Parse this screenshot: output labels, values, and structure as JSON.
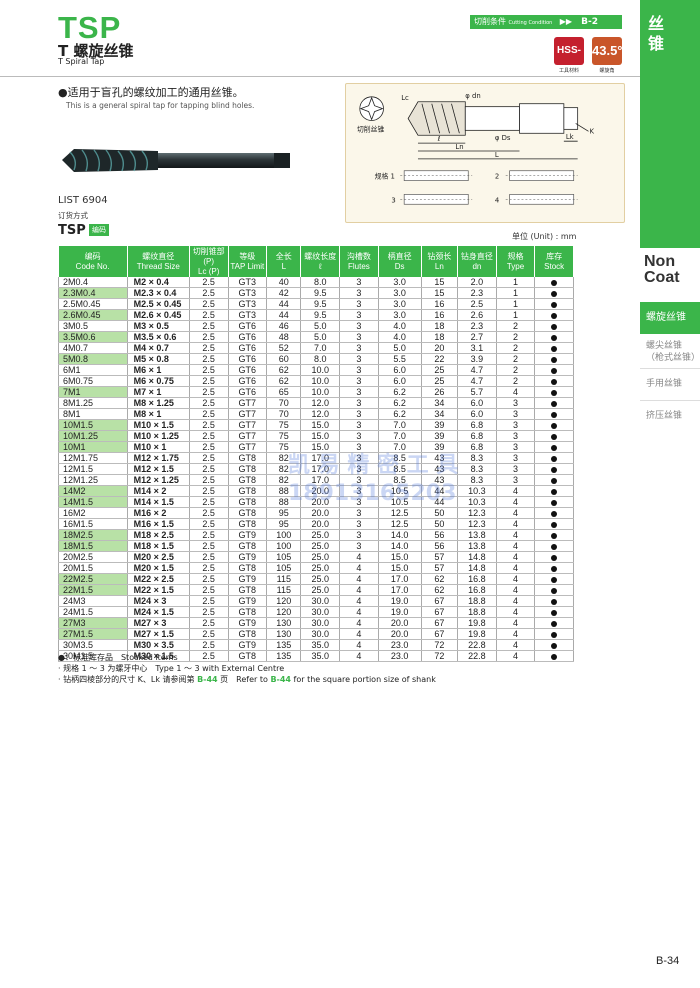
{
  "header": {
    "code": "TSP",
    "title_cn": "T 螺旋丝锥",
    "title_en": "T Spiral Tap",
    "cutting_condition_cn": "切削条件",
    "cutting_condition_en": "Cutting Condition",
    "cutting_condition_ref": "B-2",
    "material_badge": "HSS-E",
    "material_caption": "工具材料",
    "angle_badge": "43.5°",
    "angle_caption": "螺旋角"
  },
  "sidebar": {
    "top_label": "丝锥",
    "category": "Non Coat",
    "items": [
      {
        "label": "螺旋丝锥",
        "active": true
      },
      {
        "label": "螺尖丝锥（枪式丝锥）",
        "active": false
      },
      {
        "label": "手用丝锥",
        "active": false
      },
      {
        "label": "挤压丝锥",
        "active": false
      }
    ]
  },
  "intro": {
    "cn": "●适用于盲孔的螺纹加工的通用丝锥。",
    "en": "This is a general spiral tap for tapping blind holes."
  },
  "diagram": {
    "labels": {
      "lc": "Lc",
      "dn": "φ dn",
      "ds": "φ Ds",
      "l_small": "ℓ",
      "ln": "Ln",
      "L": "L",
      "lk": "Lk",
      "k": "K",
      "cutting_flute": "切削丝锥",
      "spec1": "规格 1",
      "spec2": "2",
      "spec3": "3",
      "spec4": "4"
    }
  },
  "list_no": "LIST 6904",
  "order_method": "订货方式",
  "order_code": "TSP",
  "order_badge": "编码",
  "unit": "单位 (Unit) : mm",
  "table": {
    "headers": [
      {
        "cn": "编码",
        "en": "Code No."
      },
      {
        "cn": "螺纹直径",
        "en": "Thread Size"
      },
      {
        "cn": "切削锥部(P)",
        "en": "Lc (P)"
      },
      {
        "cn": "等级",
        "en": "TAP Limit"
      },
      {
        "cn": "全长",
        "en": "L"
      },
      {
        "cn": "螺纹长度",
        "en": "ℓ"
      },
      {
        "cn": "沟槽数",
        "en": "Flutes"
      },
      {
        "cn": "柄直径",
        "en": "Ds"
      },
      {
        "cn": "钻颈长",
        "en": "Ln"
      },
      {
        "cn": "钻身直径",
        "en": "dn"
      },
      {
        "cn": "规格",
        "en": "Type"
      },
      {
        "cn": "库存",
        "en": "Stock"
      }
    ],
    "rows": [
      [
        "2M0.4",
        "M2 × 0.4",
        "2.5",
        "GT3",
        "40",
        "8.0",
        "3",
        "3.0",
        "15",
        "2.0",
        "1"
      ],
      [
        "2.3M0.4",
        "M2.3 × 0.4",
        "2.5",
        "GT3",
        "42",
        "9.5",
        "3",
        "3.0",
        "15",
        "2.3",
        "1"
      ],
      [
        "2.5M0.45",
        "M2.5 × 0.45",
        "2.5",
        "GT3",
        "44",
        "9.5",
        "3",
        "3.0",
        "16",
        "2.5",
        "1"
      ],
      [
        "2.6M0.45",
        "M2.6 × 0.45",
        "2.5",
        "GT3",
        "44",
        "9.5",
        "3",
        "3.0",
        "16",
        "2.6",
        "1"
      ],
      [
        "3M0.5",
        "M3 × 0.5",
        "2.5",
        "GT6",
        "46",
        "5.0",
        "3",
        "4.0",
        "18",
        "2.3",
        "2"
      ],
      [
        "3.5M0.6",
        "M3.5 × 0.6",
        "2.5",
        "GT6",
        "48",
        "5.0",
        "3",
        "4.0",
        "18",
        "2.7",
        "2"
      ],
      [
        "4M0.7",
        "M4 × 0.7",
        "2.5",
        "GT6",
        "52",
        "7.0",
        "3",
        "5.0",
        "20",
        "3.1",
        "2"
      ],
      [
        "5M0.8",
        "M5 × 0.8",
        "2.5",
        "GT6",
        "60",
        "8.0",
        "3",
        "5.5",
        "22",
        "3.9",
        "2"
      ],
      [
        "6M1",
        "M6 × 1",
        "2.5",
        "GT6",
        "62",
        "10.0",
        "3",
        "6.0",
        "25",
        "4.7",
        "2"
      ],
      [
        "6M0.75",
        "M6 × 0.75",
        "2.5",
        "GT6",
        "62",
        "10.0",
        "3",
        "6.0",
        "25",
        "4.7",
        "2"
      ],
      [
        "7M1",
        "M7 × 1",
        "2.5",
        "GT6",
        "65",
        "10.0",
        "3",
        "6.2",
        "26",
        "5.7",
        "4"
      ],
      [
        "8M1.25",
        "M8 × 1.25",
        "2.5",
        "GT7",
        "70",
        "12.0",
        "3",
        "6.2",
        "34",
        "6.0",
        "3"
      ],
      [
        "8M1",
        "M8 × 1",
        "2.5",
        "GT7",
        "70",
        "12.0",
        "3",
        "6.2",
        "34",
        "6.0",
        "3"
      ],
      [
        "10M1.5",
        "M10 × 1.5",
        "2.5",
        "GT7",
        "75",
        "15.0",
        "3",
        "7.0",
        "39",
        "6.8",
        "3"
      ],
      [
        "10M1.25",
        "M10 × 1.25",
        "2.5",
        "GT7",
        "75",
        "15.0",
        "3",
        "7.0",
        "39",
        "6.8",
        "3"
      ],
      [
        "10M1",
        "M10 × 1",
        "2.5",
        "GT7",
        "75",
        "15.0",
        "3",
        "7.0",
        "39",
        "6.8",
        "3"
      ],
      [
        "12M1.75",
        "M12 × 1.75",
        "2.5",
        "GT8",
        "82",
        "17.0",
        "3",
        "8.5",
        "43",
        "8.3",
        "3"
      ],
      [
        "12M1.5",
        "M12 × 1.5",
        "2.5",
        "GT8",
        "82",
        "17.0",
        "3",
        "8.5",
        "43",
        "8.3",
        "3"
      ],
      [
        "12M1.25",
        "M12 × 1.25",
        "2.5",
        "GT8",
        "82",
        "17.0",
        "3",
        "8.5",
        "43",
        "8.3",
        "3"
      ],
      [
        "14M2",
        "M14 × 2",
        "2.5",
        "GT8",
        "88",
        "20.0",
        "3",
        "10.5",
        "44",
        "10.3",
        "4"
      ],
      [
        "14M1.5",
        "M14 × 1.5",
        "2.5",
        "GT8",
        "88",
        "20.0",
        "3",
        "10.5",
        "44",
        "10.3",
        "4"
      ],
      [
        "16M2",
        "M16 × 2",
        "2.5",
        "GT8",
        "95",
        "20.0",
        "3",
        "12.5",
        "50",
        "12.3",
        "4"
      ],
      [
        "16M1.5",
        "M16 × 1.5",
        "2.5",
        "GT8",
        "95",
        "20.0",
        "3",
        "12.5",
        "50",
        "12.3",
        "4"
      ],
      [
        "18M2.5",
        "M18 × 2.5",
        "2.5",
        "GT9",
        "100",
        "25.0",
        "3",
        "14.0",
        "56",
        "13.8",
        "4"
      ],
      [
        "18M1.5",
        "M18 × 1.5",
        "2.5",
        "GT8",
        "100",
        "25.0",
        "3",
        "14.0",
        "56",
        "13.8",
        "4"
      ],
      [
        "20M2.5",
        "M20 × 2.5",
        "2.5",
        "GT9",
        "105",
        "25.0",
        "4",
        "15.0",
        "57",
        "14.8",
        "4"
      ],
      [
        "20M1.5",
        "M20 × 1.5",
        "2.5",
        "GT8",
        "105",
        "25.0",
        "4",
        "15.0",
        "57",
        "14.8",
        "4"
      ],
      [
        "22M2.5",
        "M22 × 2.5",
        "2.5",
        "GT9",
        "115",
        "25.0",
        "4",
        "17.0",
        "62",
        "16.8",
        "4"
      ],
      [
        "22M1.5",
        "M22 × 1.5",
        "2.5",
        "GT8",
        "115",
        "25.0",
        "4",
        "17.0",
        "62",
        "16.8",
        "4"
      ],
      [
        "24M3",
        "M24 × 3",
        "2.5",
        "GT9",
        "120",
        "30.0",
        "4",
        "19.0",
        "67",
        "18.8",
        "4"
      ],
      [
        "24M1.5",
        "M24 × 1.5",
        "2.5",
        "GT8",
        "120",
        "30.0",
        "4",
        "19.0",
        "67",
        "18.8",
        "4"
      ],
      [
        "27M3",
        "M27 × 3",
        "2.5",
        "GT9",
        "130",
        "30.0",
        "4",
        "20.0",
        "67",
        "19.8",
        "4"
      ],
      [
        "27M1.5",
        "M27 × 1.5",
        "2.5",
        "GT8",
        "130",
        "30.0",
        "4",
        "20.0",
        "67",
        "19.8",
        "4"
      ],
      [
        "30M3.5",
        "M30 × 3.5",
        "2.5",
        "GT9",
        "135",
        "35.0",
        "4",
        "23.0",
        "72",
        "22.8",
        "4"
      ],
      [
        "30M1.5",
        "M30 × 1.5",
        "2.5",
        "GT8",
        "135",
        "35.0",
        "4",
        "23.0",
        "72",
        "22.8",
        "4"
      ]
    ],
    "stock_highlight": [
      "2.3M0.4",
      "2.6M0.45",
      "3.5M0.6",
      "5M0.8",
      "7M1",
      "10M1.5",
      "10M1.25",
      "10M1",
      "14M2",
      "14M1.5",
      "18M2.5",
      "18M1.5",
      "22M2.5",
      "22M1.5",
      "27M3",
      "27M1.5"
    ]
  },
  "notes": [
    {
      "text": "●：标准库存品　Stocked items"
    },
    {
      "text": "· 规格 1 ～ 3 为螺牙中心　Type 1 ～ 3 with External Centre"
    },
    {
      "pre": "· 钻柄四棱部分的尺寸 K、Lk 请参阅第 ",
      "ref": "B-44",
      "mid": " 页　Refer to ",
      "ref2": "B-44",
      "post": " for the square portion size of shank"
    }
  ],
  "watermark": {
    "line1": "凯 易 精 密 工 具",
    "line2": "18913165203"
  },
  "page_number": "B-34",
  "colors": {
    "brand_green": "#3bb54a",
    "stock_green": "#b8e1a6",
    "hss_red": "#c4202e",
    "angle_orange": "#c9562a"
  }
}
